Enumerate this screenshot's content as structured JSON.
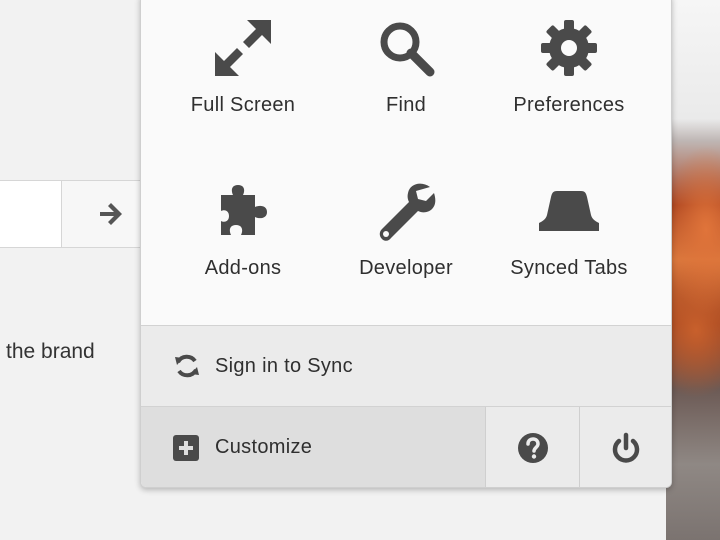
{
  "page": {
    "visible_text": "the brand"
  },
  "menu": {
    "tiles": [
      {
        "label": "Full Screen",
        "icon": "fullscreen-icon"
      },
      {
        "label": "Find",
        "icon": "search-icon"
      },
      {
        "label": "Preferences",
        "icon": "gear-icon"
      },
      {
        "label": "Add-ons",
        "icon": "puzzle-piece-icon"
      },
      {
        "label": "Developer",
        "icon": "wrench-icon"
      },
      {
        "label": "Synced Tabs",
        "icon": "synced-tabs-icon"
      }
    ],
    "sync_label": "Sign in to Sync",
    "customize_label": "Customize",
    "footer_icons": [
      "help-icon",
      "power-icon"
    ]
  },
  "colors": {
    "icon": "#4a4a4a",
    "panel_bg": "#fafafa",
    "footer_bg": "#ebebeb",
    "customize_bg": "#dedede"
  }
}
